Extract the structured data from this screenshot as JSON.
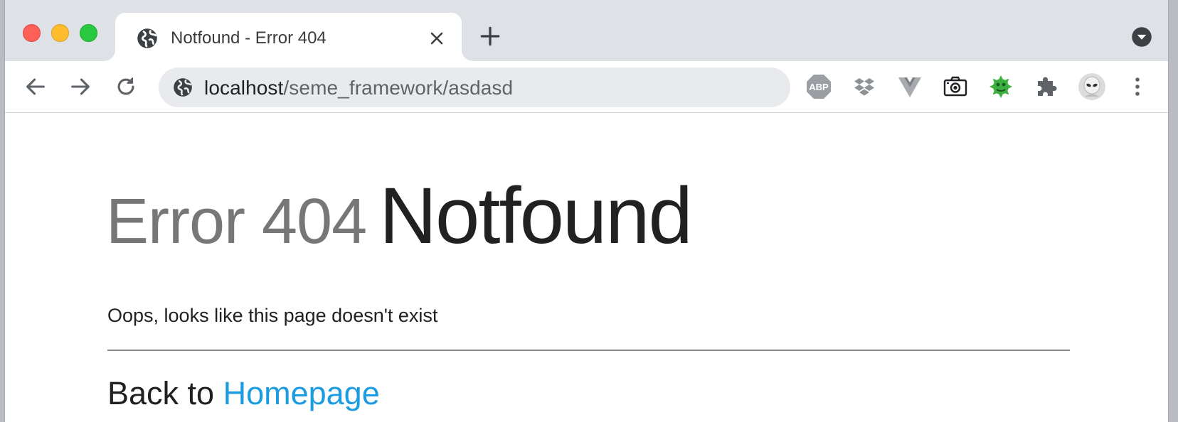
{
  "tab": {
    "title": "Notfound - Error 404"
  },
  "omnibox": {
    "host": "localhost",
    "path": "/seme_framework/asdasd"
  },
  "extensions": [
    {
      "name": "adblock-plus-icon",
      "label": "ABP"
    },
    {
      "name": "dropbox-icon"
    },
    {
      "name": "vue-devtools-icon"
    },
    {
      "name": "camera-icon"
    },
    {
      "name": "bug-extension-icon"
    },
    {
      "name": "extensions-puzzle-icon"
    },
    {
      "name": "profile-avatar-icon"
    },
    {
      "name": "menu-kebab-icon"
    }
  ],
  "colors": {
    "link": "#1b9be0",
    "muted_heading": "#777777",
    "bug_extension": "#3bb040"
  },
  "page": {
    "heading_muted": "Error 404",
    "heading_strong": "Notfound",
    "message": "Oops, looks like this page doesn't exist",
    "back_prefix": "Back to",
    "back_link": "Homepage"
  }
}
